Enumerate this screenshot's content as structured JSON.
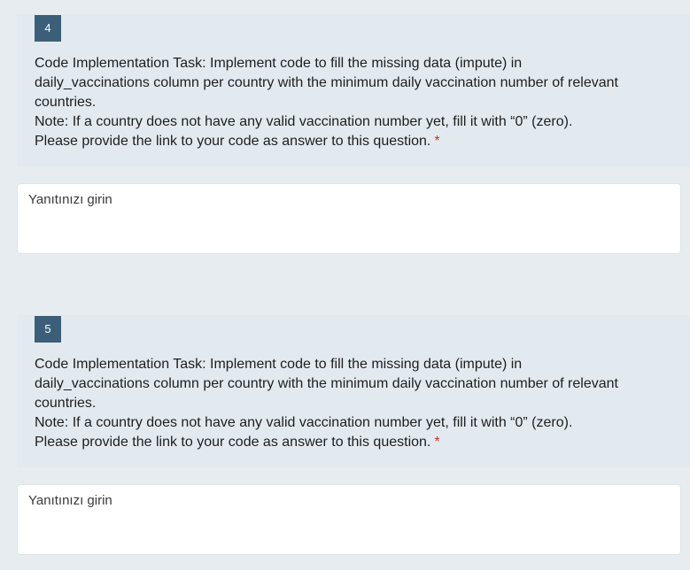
{
  "questions": [
    {
      "number": "4",
      "lines": [
        "Code Implementation Task: Implement code to fill the missing data (impute) in",
        "daily_vaccinations column per country with the minimum daily vaccination number of relevant",
        "countries.",
        "Note: If a country does not have any valid vaccination number yet, fill it with “0” (zero).",
        "Please  provide the link to your code as answer to this question."
      ],
      "required_mark": "*",
      "answer_placeholder": "Yanıtınızı girin"
    },
    {
      "number": "5",
      "lines": [
        "Code Implementation Task: Implement code to fill the missing data (impute) in",
        "daily_vaccinations column per country with the minimum daily vaccination number of relevant",
        "countries.",
        "Note: If a country does not have any valid vaccination number yet, fill it with “0” (zero).",
        "Please  provide the link to your code as answer to this question."
      ],
      "required_mark": "*",
      "answer_placeholder": "Yanıtınızı girin"
    }
  ]
}
